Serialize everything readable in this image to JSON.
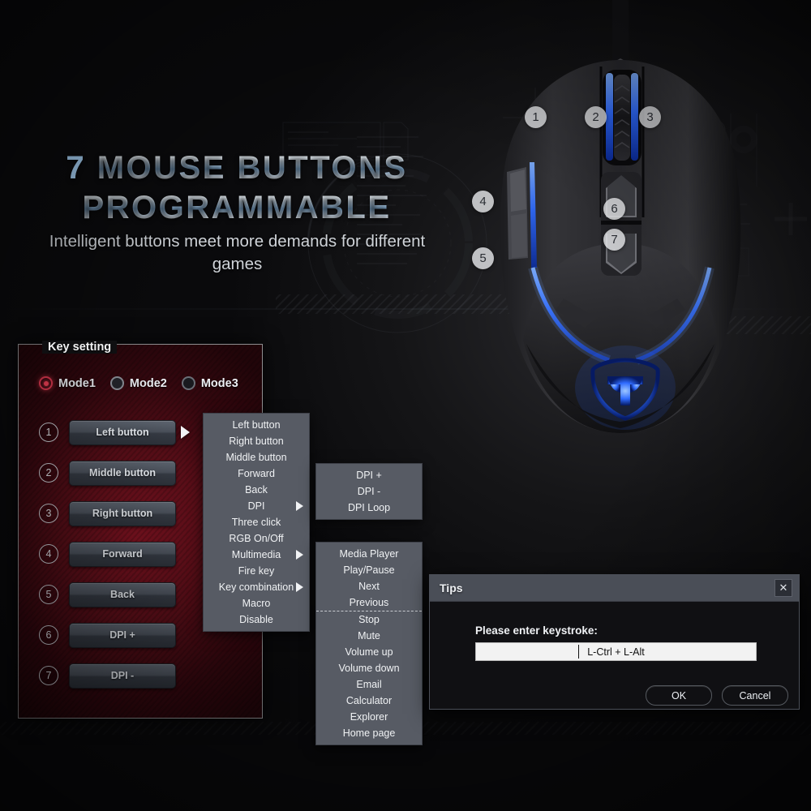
{
  "headline": {
    "line1_number": "7",
    "line1_rest": " MOUSE BUTTONS",
    "line2": "PROGRAMMABLE",
    "subhead": "Intelligent buttons meet more demands for different games"
  },
  "mouse": {
    "callouts": [
      {
        "id": "1",
        "label": "1"
      },
      {
        "id": "2",
        "label": "2"
      },
      {
        "id": "3",
        "label": "3"
      },
      {
        "id": "4",
        "label": "4"
      },
      {
        "id": "5",
        "label": "5"
      },
      {
        "id": "6",
        "label": "6"
      },
      {
        "id": "7",
        "label": "7"
      }
    ]
  },
  "panel": {
    "legend": "Key setting",
    "modes": [
      {
        "label": "Mode1",
        "selected": true
      },
      {
        "label": "Mode2",
        "selected": false
      },
      {
        "label": "Mode3",
        "selected": false
      }
    ],
    "rows": [
      {
        "num": "1",
        "label": "Left button"
      },
      {
        "num": "2",
        "label": "Middle button"
      },
      {
        "num": "3",
        "label": "Right button"
      },
      {
        "num": "4",
        "label": "Forward"
      },
      {
        "num": "5",
        "label": "Back"
      },
      {
        "num": "6",
        "label": "DPI +"
      },
      {
        "num": "7",
        "label": "DPI -"
      }
    ]
  },
  "menu_main": {
    "items": [
      {
        "label": "Left button",
        "submenu": false
      },
      {
        "label": "Right button",
        "submenu": false
      },
      {
        "label": "Middle button",
        "submenu": false
      },
      {
        "label": "Forward",
        "submenu": false
      },
      {
        "label": "Back",
        "submenu": false
      },
      {
        "label": "DPI",
        "submenu": true
      },
      {
        "label": "Three click",
        "submenu": false
      },
      {
        "label": "RGB On/Off",
        "submenu": false
      },
      {
        "label": "Multimedia",
        "submenu": true
      },
      {
        "label": "Fire key",
        "submenu": false
      },
      {
        "label": "Key combination",
        "submenu": true
      },
      {
        "label": "Macro",
        "submenu": false
      },
      {
        "label": "Disable",
        "submenu": false
      }
    ]
  },
  "menu_dpi": {
    "items": [
      {
        "label": "DPI +"
      },
      {
        "label": "DPI -"
      },
      {
        "label": "DPI Loop"
      }
    ]
  },
  "menu_multimedia": {
    "items_top": [
      {
        "label": "Media Player"
      },
      {
        "label": "Play/Pause"
      },
      {
        "label": "Next"
      },
      {
        "label": "Previous"
      }
    ],
    "items_bottom": [
      {
        "label": "Stop"
      },
      {
        "label": "Mute"
      },
      {
        "label": "Volume up"
      },
      {
        "label": "Volume down"
      },
      {
        "label": "Email"
      },
      {
        "label": "Calculator"
      },
      {
        "label": "Explorer"
      },
      {
        "label": "Home page"
      }
    ]
  },
  "dialog": {
    "title": "Tips",
    "close_label": "✕",
    "prompt": "Please enter keystroke:",
    "input_value": "L-Ctrl + L-Alt",
    "ok_label": "OK",
    "cancel_label": "Cancel"
  },
  "colors": {
    "accent_red": "#d9384e",
    "panel_red": "#5a0e18",
    "menu_gray": "#575b64",
    "led_blue": "#2f6bff"
  }
}
